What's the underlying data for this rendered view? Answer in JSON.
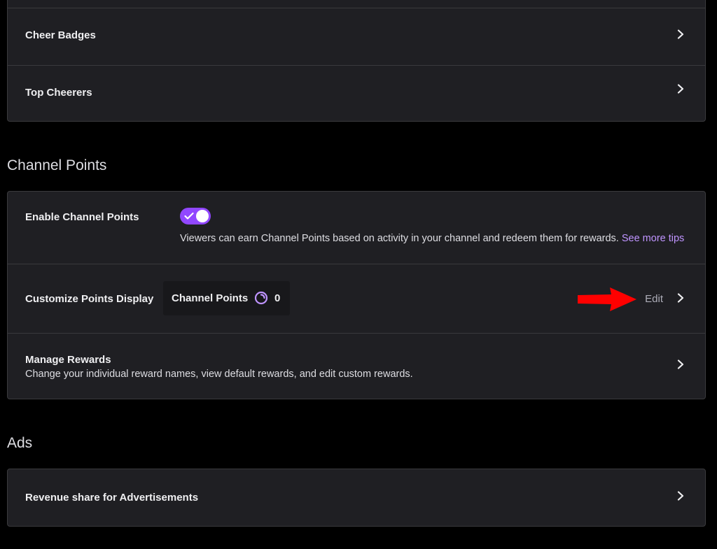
{
  "bits_card": {
    "items": [
      {
        "label": "Cheer Badges"
      },
      {
        "label": "Top Cheerers"
      }
    ]
  },
  "channel_points": {
    "section_title": "Channel Points",
    "enable": {
      "label": "Enable Channel Points",
      "enabled": true,
      "description": "Viewers can earn Channel Points based on activity in your channel and redeem them for rewards.",
      "tips_link": "See more tips"
    },
    "customize": {
      "label": "Customize Points Display",
      "preview_name": "Channel Points",
      "preview_count": "0",
      "edit_label": "Edit"
    },
    "manage": {
      "label": "Manage Rewards",
      "description": "Change your individual reward names, view default rewards, and edit custom rewards."
    }
  },
  "ads": {
    "section_title": "Ads",
    "items": [
      {
        "label": "Revenue share for Advertisements"
      }
    ]
  },
  "colors": {
    "accent": "#9147ff",
    "link": "#bf94ff",
    "annotation_arrow": "#ff0000",
    "card_background": "#1f1f23",
    "page_background": "#000000"
  },
  "icons": {
    "chevron": "chevron-right-icon",
    "points": "channel-points-icon",
    "check": "check-icon",
    "annotation": "red-arrow-icon"
  }
}
